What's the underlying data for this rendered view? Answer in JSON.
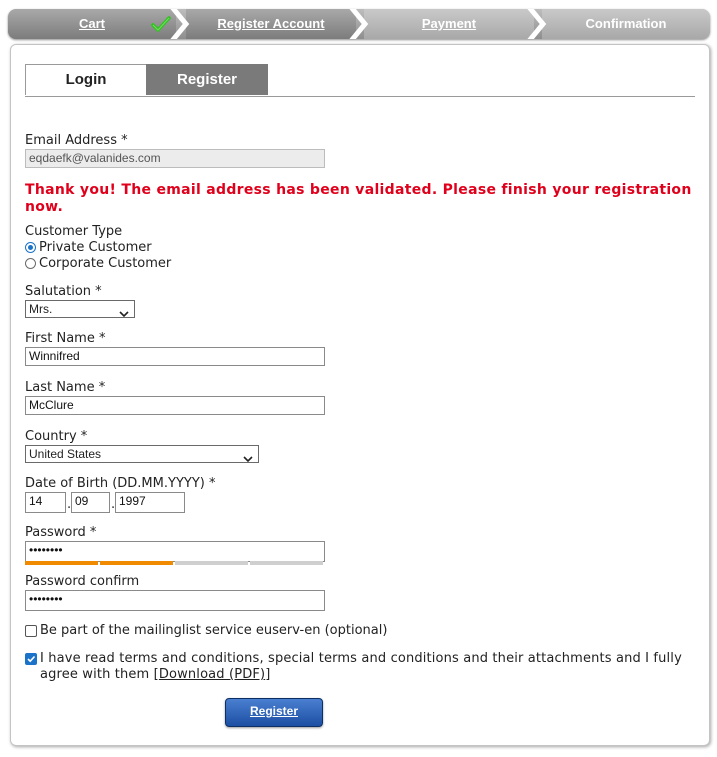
{
  "steps": {
    "cart": "Cart",
    "register_account": "Register Account",
    "payment": "Payment",
    "confirmation": "Confirmation"
  },
  "tabs": {
    "login": "Login",
    "register": "Register"
  },
  "form": {
    "email_label": "Email Address *",
    "email_value": "eqdaefk@valanides.com",
    "notice": "Thank you! The email address has been validated. Please finish your registration now.",
    "customer_type_label": "Customer Type",
    "customer_type_options": [
      "Private Customer",
      "Corporate Customer"
    ],
    "salutation_label": "Salutation *",
    "salutation_value": "Mrs.",
    "first_name_label": "First Name *",
    "first_name_value": "Winnifred",
    "last_name_label": "Last Name *",
    "last_name_value": "McClure",
    "country_label": "Country *",
    "country_value": "United States",
    "dob_label": "Date of Birth (DD.MM.YYYY) *",
    "dob_day": "14",
    "dob_month": "09",
    "dob_year": "1997",
    "dob_sep": ".",
    "password_label": "Password *",
    "password_value": "••••••••",
    "password_strength_filled": 2,
    "password_strength_total": 4,
    "password_confirm_label": "Password confirm",
    "password_confirm_value": "••••••••",
    "mailinglist_label": "Be part of the mailinglist service euserv-en (optional)",
    "terms_text": "I have read terms and conditions, special terms and conditions and their attachments and I fully agree with them [",
    "terms_link": "Download (PDF)",
    "terms_end": "]",
    "register_button": "Register"
  },
  "colors": {
    "notice": "#e0001b",
    "accent": "#1a73c9",
    "strength": "#f08a00",
    "button": "#1c4fa3"
  },
  "icons": {
    "cart_done": "checkmark-icon",
    "dropdown": "chevron-down-icon"
  }
}
